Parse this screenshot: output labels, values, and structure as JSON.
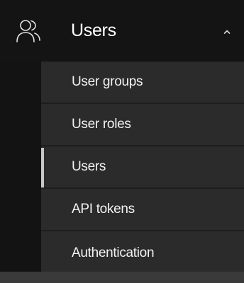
{
  "nav": {
    "section_label": "Users",
    "section_icon": "users-icon",
    "expanded": true,
    "items": [
      {
        "label": "User groups",
        "active": false
      },
      {
        "label": "User roles",
        "active": false
      },
      {
        "label": "Users",
        "active": true
      },
      {
        "label": "API tokens",
        "active": false
      },
      {
        "label": "Authentication",
        "active": false
      }
    ]
  },
  "colors": {
    "background": "#141414",
    "submenu_background": "#2b2b2b",
    "text": "#ffffff",
    "active_indicator": "#c8c8c8"
  }
}
